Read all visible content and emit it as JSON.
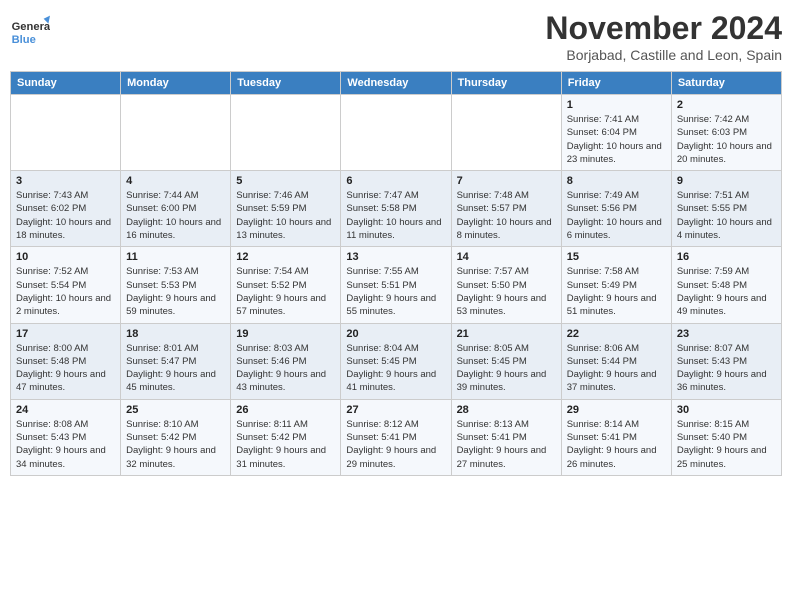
{
  "logo": {
    "line1": "General",
    "line2": "Blue"
  },
  "title": "November 2024",
  "location": "Borjabad, Castille and Leon, Spain",
  "days_of_week": [
    "Sunday",
    "Monday",
    "Tuesday",
    "Wednesday",
    "Thursday",
    "Friday",
    "Saturday"
  ],
  "weeks": [
    [
      null,
      null,
      null,
      null,
      null,
      {
        "day": "1",
        "sunrise": "Sunrise: 7:41 AM",
        "sunset": "Sunset: 6:04 PM",
        "daylight": "Daylight: 10 hours and 23 minutes."
      },
      {
        "day": "2",
        "sunrise": "Sunrise: 7:42 AM",
        "sunset": "Sunset: 6:03 PM",
        "daylight": "Daylight: 10 hours and 20 minutes."
      }
    ],
    [
      {
        "day": "3",
        "sunrise": "Sunrise: 7:43 AM",
        "sunset": "Sunset: 6:02 PM",
        "daylight": "Daylight: 10 hours and 18 minutes."
      },
      {
        "day": "4",
        "sunrise": "Sunrise: 7:44 AM",
        "sunset": "Sunset: 6:00 PM",
        "daylight": "Daylight: 10 hours and 16 minutes."
      },
      {
        "day": "5",
        "sunrise": "Sunrise: 7:46 AM",
        "sunset": "Sunset: 5:59 PM",
        "daylight": "Daylight: 10 hours and 13 minutes."
      },
      {
        "day": "6",
        "sunrise": "Sunrise: 7:47 AM",
        "sunset": "Sunset: 5:58 PM",
        "daylight": "Daylight: 10 hours and 11 minutes."
      },
      {
        "day": "7",
        "sunrise": "Sunrise: 7:48 AM",
        "sunset": "Sunset: 5:57 PM",
        "daylight": "Daylight: 10 hours and 8 minutes."
      },
      {
        "day": "8",
        "sunrise": "Sunrise: 7:49 AM",
        "sunset": "Sunset: 5:56 PM",
        "daylight": "Daylight: 10 hours and 6 minutes."
      },
      {
        "day": "9",
        "sunrise": "Sunrise: 7:51 AM",
        "sunset": "Sunset: 5:55 PM",
        "daylight": "Daylight: 10 hours and 4 minutes."
      }
    ],
    [
      {
        "day": "10",
        "sunrise": "Sunrise: 7:52 AM",
        "sunset": "Sunset: 5:54 PM",
        "daylight": "Daylight: 10 hours and 2 minutes."
      },
      {
        "day": "11",
        "sunrise": "Sunrise: 7:53 AM",
        "sunset": "Sunset: 5:53 PM",
        "daylight": "Daylight: 9 hours and 59 minutes."
      },
      {
        "day": "12",
        "sunrise": "Sunrise: 7:54 AM",
        "sunset": "Sunset: 5:52 PM",
        "daylight": "Daylight: 9 hours and 57 minutes."
      },
      {
        "day": "13",
        "sunrise": "Sunrise: 7:55 AM",
        "sunset": "Sunset: 5:51 PM",
        "daylight": "Daylight: 9 hours and 55 minutes."
      },
      {
        "day": "14",
        "sunrise": "Sunrise: 7:57 AM",
        "sunset": "Sunset: 5:50 PM",
        "daylight": "Daylight: 9 hours and 53 minutes."
      },
      {
        "day": "15",
        "sunrise": "Sunrise: 7:58 AM",
        "sunset": "Sunset: 5:49 PM",
        "daylight": "Daylight: 9 hours and 51 minutes."
      },
      {
        "day": "16",
        "sunrise": "Sunrise: 7:59 AM",
        "sunset": "Sunset: 5:48 PM",
        "daylight": "Daylight: 9 hours and 49 minutes."
      }
    ],
    [
      {
        "day": "17",
        "sunrise": "Sunrise: 8:00 AM",
        "sunset": "Sunset: 5:48 PM",
        "daylight": "Daylight: 9 hours and 47 minutes."
      },
      {
        "day": "18",
        "sunrise": "Sunrise: 8:01 AM",
        "sunset": "Sunset: 5:47 PM",
        "daylight": "Daylight: 9 hours and 45 minutes."
      },
      {
        "day": "19",
        "sunrise": "Sunrise: 8:03 AM",
        "sunset": "Sunset: 5:46 PM",
        "daylight": "Daylight: 9 hours and 43 minutes."
      },
      {
        "day": "20",
        "sunrise": "Sunrise: 8:04 AM",
        "sunset": "Sunset: 5:45 PM",
        "daylight": "Daylight: 9 hours and 41 minutes."
      },
      {
        "day": "21",
        "sunrise": "Sunrise: 8:05 AM",
        "sunset": "Sunset: 5:45 PM",
        "daylight": "Daylight: 9 hours and 39 minutes."
      },
      {
        "day": "22",
        "sunrise": "Sunrise: 8:06 AM",
        "sunset": "Sunset: 5:44 PM",
        "daylight": "Daylight: 9 hours and 37 minutes."
      },
      {
        "day": "23",
        "sunrise": "Sunrise: 8:07 AM",
        "sunset": "Sunset: 5:43 PM",
        "daylight": "Daylight: 9 hours and 36 minutes."
      }
    ],
    [
      {
        "day": "24",
        "sunrise": "Sunrise: 8:08 AM",
        "sunset": "Sunset: 5:43 PM",
        "daylight": "Daylight: 9 hours and 34 minutes."
      },
      {
        "day": "25",
        "sunrise": "Sunrise: 8:10 AM",
        "sunset": "Sunset: 5:42 PM",
        "daylight": "Daylight: 9 hours and 32 minutes."
      },
      {
        "day": "26",
        "sunrise": "Sunrise: 8:11 AM",
        "sunset": "Sunset: 5:42 PM",
        "daylight": "Daylight: 9 hours and 31 minutes."
      },
      {
        "day": "27",
        "sunrise": "Sunrise: 8:12 AM",
        "sunset": "Sunset: 5:41 PM",
        "daylight": "Daylight: 9 hours and 29 minutes."
      },
      {
        "day": "28",
        "sunrise": "Sunrise: 8:13 AM",
        "sunset": "Sunset: 5:41 PM",
        "daylight": "Daylight: 9 hours and 27 minutes."
      },
      {
        "day": "29",
        "sunrise": "Sunrise: 8:14 AM",
        "sunset": "Sunset: 5:41 PM",
        "daylight": "Daylight: 9 hours and 26 minutes."
      },
      {
        "day": "30",
        "sunrise": "Sunrise: 8:15 AM",
        "sunset": "Sunset: 5:40 PM",
        "daylight": "Daylight: 9 hours and 25 minutes."
      }
    ]
  ]
}
